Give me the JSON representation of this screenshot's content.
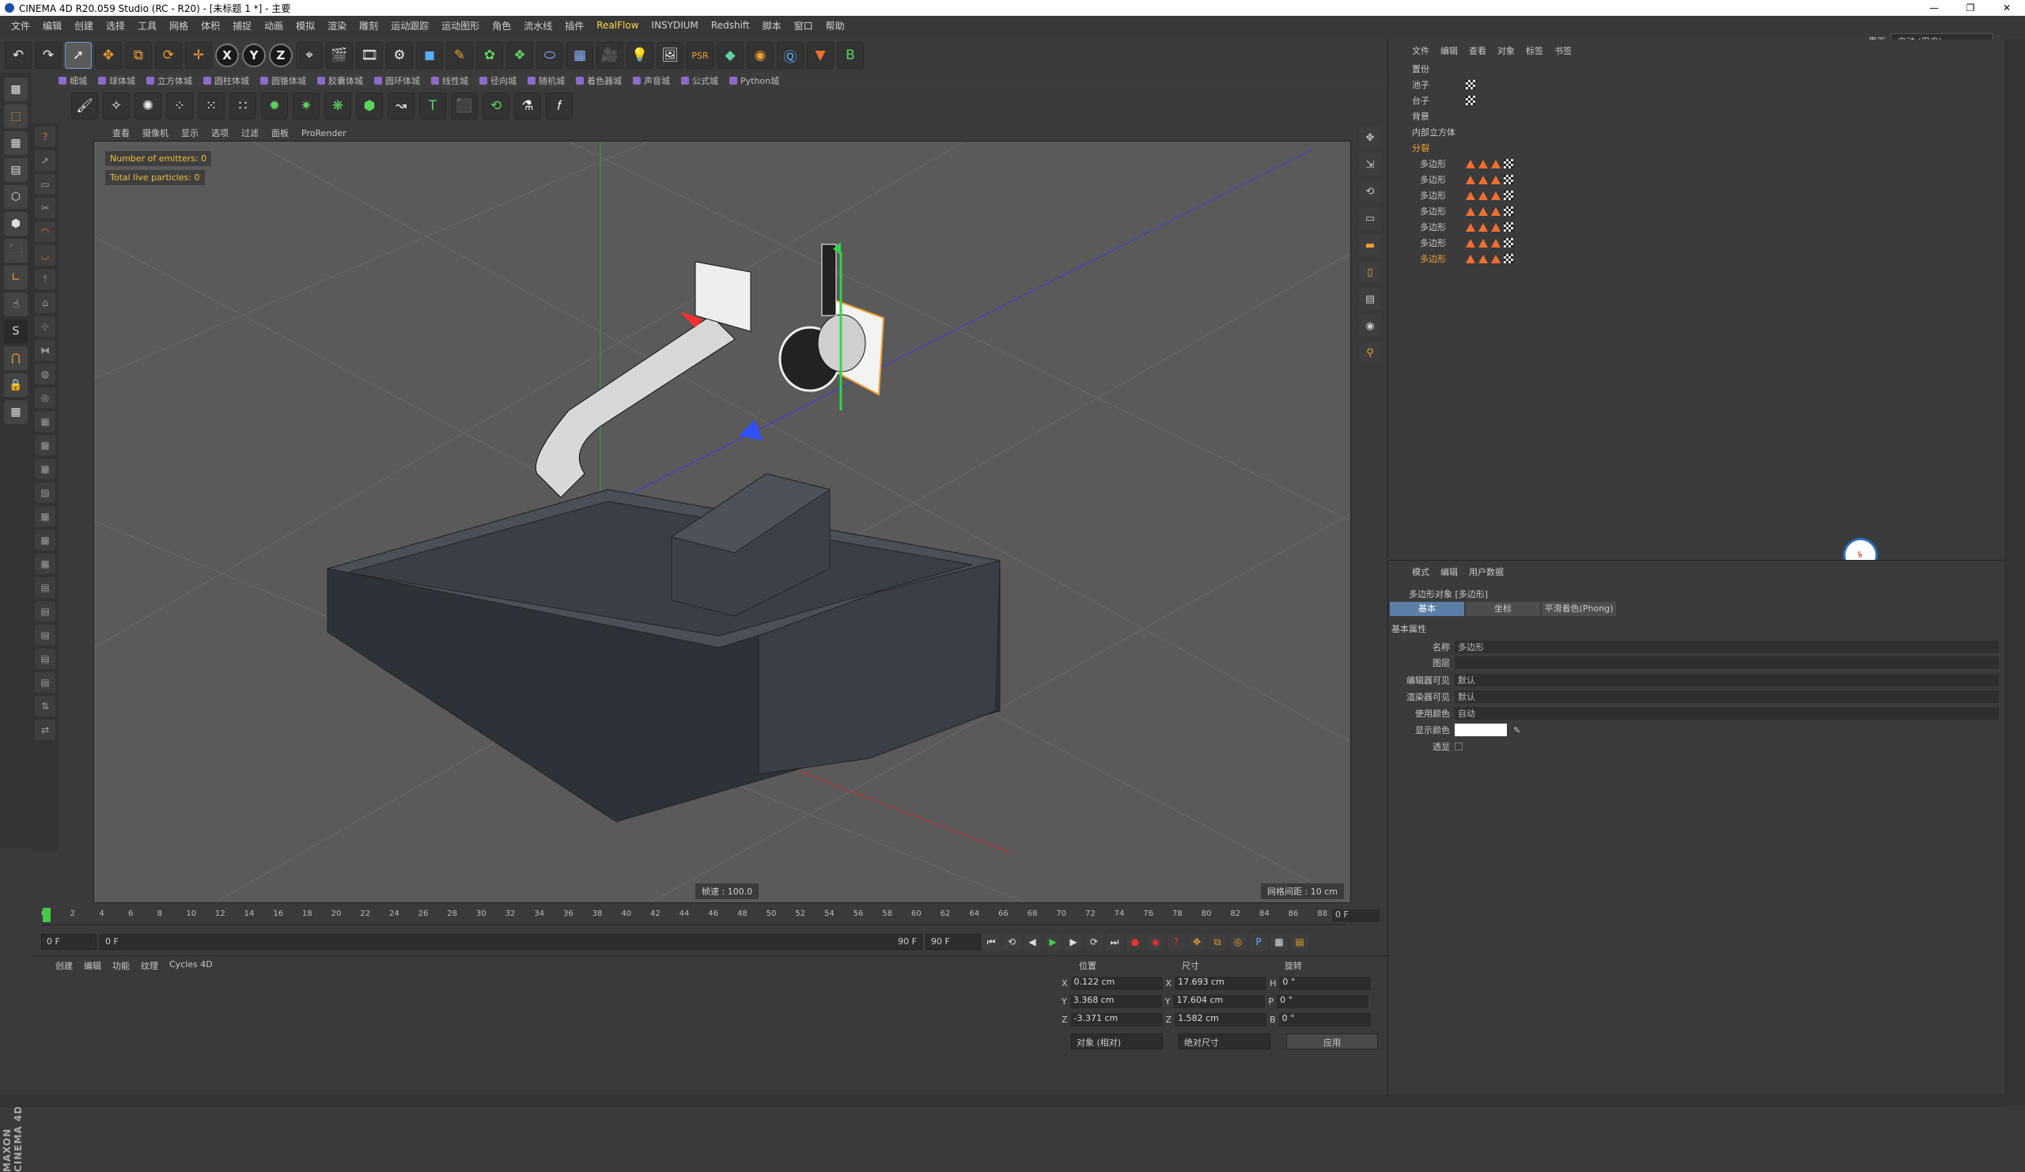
{
  "window": {
    "title": "CINEMA 4D R20.059 Studio (RC - R20) - [未标题 1 *] - 主要",
    "controls": [
      "—",
      "❐",
      "✕"
    ]
  },
  "menu": [
    "文件",
    "编辑",
    "创建",
    "选择",
    "工具",
    "网格",
    "体积",
    "捕捉",
    "动画",
    "模拟",
    "渲染",
    "雕刻",
    "运动跟踪",
    "运动图形",
    "角色",
    "流水线",
    "插件",
    "RealFlow",
    "INSYDIUM",
    "Redshift",
    "脚本",
    "窗口",
    "帮助"
  ],
  "layout": {
    "label": "界面",
    "value": "启动 (用户)"
  },
  "toolbar2": [
    "细城",
    "球体城",
    "立方体城",
    "圆柱体城",
    "圆锥体城",
    "胶囊体城",
    "圆环体城",
    "线性城",
    "径向城",
    "随机城",
    "着色器城",
    "声音城",
    "公式城",
    "Python城"
  ],
  "viewport": {
    "menu": [
      "查看",
      "摄像机",
      "显示",
      "选项",
      "过滤",
      "面板",
      "ProRender"
    ],
    "hud_emitters": "Number of emitters: 0",
    "hud_particles": "Total live particles: 0",
    "fps": "帧速 : 100.0",
    "grid": "网格间距 : 10 cm"
  },
  "timeline": {
    "ticks": [
      "0",
      "2",
      "4",
      "6",
      "8",
      "10",
      "12",
      "14",
      "16",
      "18",
      "20",
      "22",
      "24",
      "26",
      "28",
      "30",
      "32",
      "34",
      "36",
      "38",
      "40",
      "42",
      "44",
      "46",
      "48",
      "50",
      "52",
      "54",
      "56",
      "58",
      "60",
      "62",
      "64",
      "66",
      "68",
      "70",
      "72",
      "74",
      "76",
      "78",
      "80",
      "82",
      "84",
      "86",
      "88",
      "90"
    ],
    "current": "0 F",
    "start": "0 F",
    "range_start": "0 F",
    "range_end": "90 F",
    "end": "90 F"
  },
  "material": {
    "menu": [
      "创建",
      "编辑",
      "功能",
      "纹理",
      "Cycles 4D"
    ]
  },
  "coords": {
    "headers": [
      "位置",
      "尺寸",
      "旋转"
    ],
    "rows": [
      {
        "axis": "X",
        "pos": "0.122 cm",
        "size_axis": "X",
        "size": "17.693 cm",
        "rot_axis": "H",
        "rot": "0 °"
      },
      {
        "axis": "Y",
        "pos": "3.368 cm",
        "size_axis": "Y",
        "size": "17.604 cm",
        "rot_axis": "P",
        "rot": "0 °"
      },
      {
        "axis": "Z",
        "pos": "-3.371 cm",
        "size_axis": "Z",
        "size": "1.582 cm",
        "rot_axis": "B",
        "rot": "0 °"
      }
    ],
    "mode": "对象 (相对)",
    "size_mode": "绝对尺寸",
    "apply": "应用"
  },
  "objects": {
    "menu": [
      "文件",
      "编辑",
      "查看",
      "对象",
      "标签",
      "书签"
    ],
    "items": [
      "置份",
      "池子",
      "台子",
      "背景",
      "内部立方体",
      "分裂",
      "多边形",
      "多边形",
      "多边形",
      "多边形",
      "多边形",
      "多边形",
      "多边形"
    ]
  },
  "attributes": {
    "menu": [
      "模式",
      "编辑",
      "用户数据"
    ],
    "object_title": "多边形对象 [多边形]",
    "tabs": [
      "基本",
      "坐标",
      "平滑着色(Phong)"
    ],
    "section": "基本属性",
    "name_label": "名称",
    "name_value": "多边形",
    "layer_label": "图层",
    "editor_vis_label": "编辑器可见",
    "editor_vis": "默认",
    "render_vis_label": "渲染器可见",
    "render_vis": "默认",
    "use_color_label": "使用颜色",
    "use_color": "自动",
    "display_color_label": "显示颜色",
    "seethrough_label": "透显"
  },
  "brand": "MAXON CINEMA 4D"
}
